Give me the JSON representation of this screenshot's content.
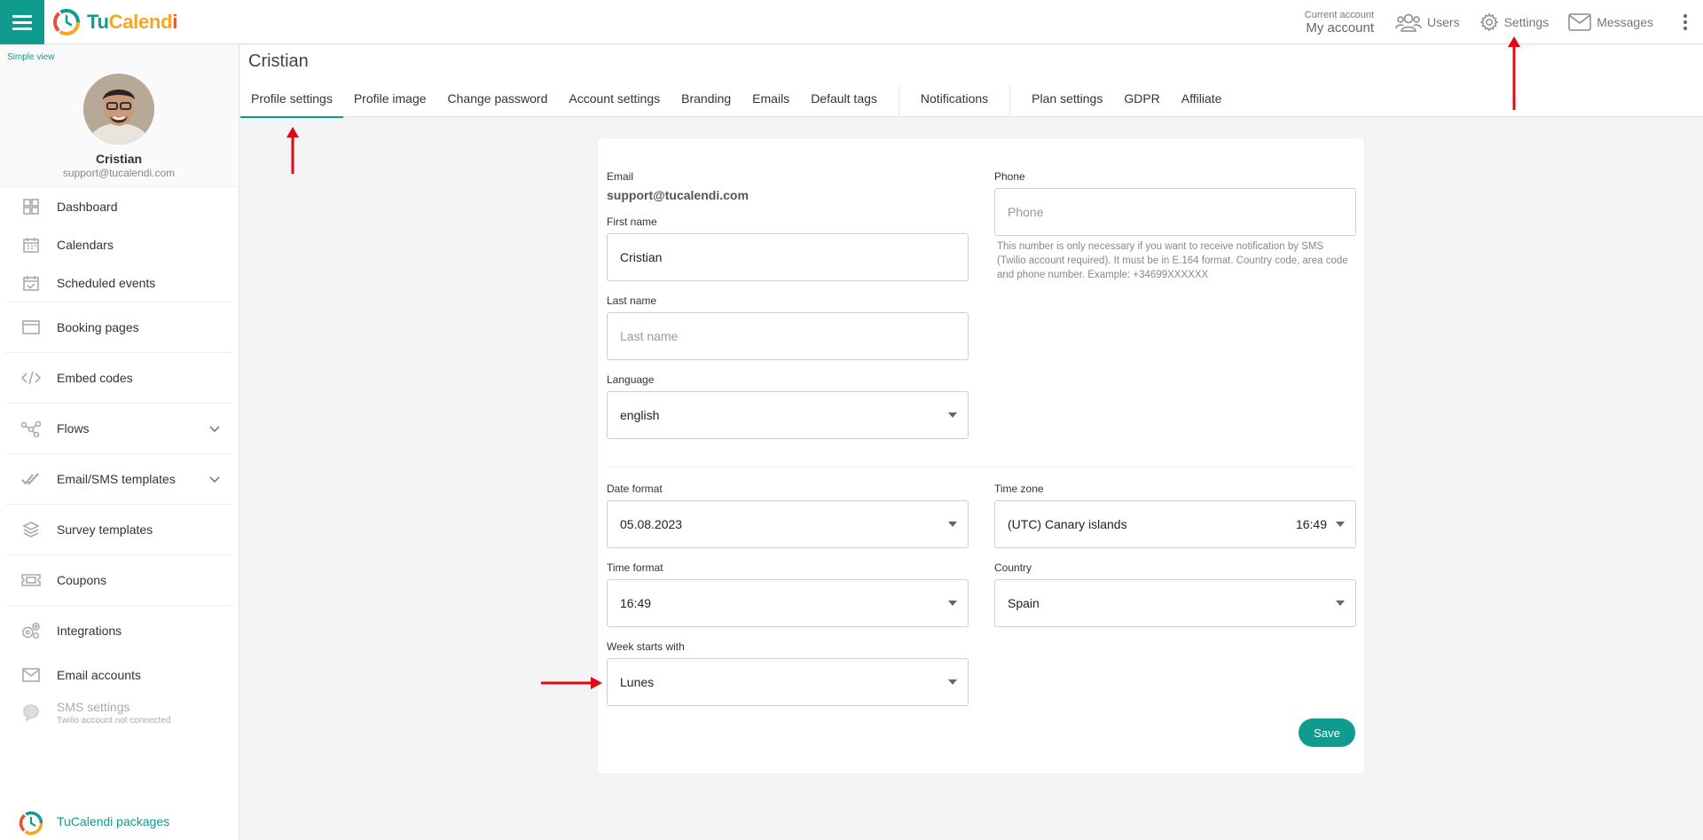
{
  "app": {
    "name_tu": "Tu",
    "name_calend": "Calend",
    "name_i": "i"
  },
  "topnav": {
    "account_small": "Current account",
    "account_big": "My account",
    "users": "Users",
    "settings": "Settings",
    "messages": "Messages"
  },
  "sidebar": {
    "simple_view": "Simple view",
    "user_name": "Cristian",
    "user_email": "support@tucalendi.com",
    "items": [
      {
        "label": "Dashboard"
      },
      {
        "label": "Calendars"
      },
      {
        "label": "Scheduled events"
      },
      {
        "label": "Booking pages"
      },
      {
        "label": "Embed codes"
      },
      {
        "label": "Flows"
      },
      {
        "label": "Email/SMS templates"
      },
      {
        "label": "Survey templates"
      },
      {
        "label": "Coupons"
      },
      {
        "label": "Integrations"
      },
      {
        "label": "Email accounts"
      },
      {
        "label": "SMS settings",
        "sub": "Twilio account not connected"
      }
    ],
    "packages": "TuCalendi packages"
  },
  "header": {
    "title": "Cristian",
    "tabs": [
      {
        "label": "Profile settings"
      },
      {
        "label": "Profile image"
      },
      {
        "label": "Change password"
      },
      {
        "label": "Account settings"
      },
      {
        "label": "Branding"
      },
      {
        "label": "Emails"
      },
      {
        "label": "Default tags"
      },
      {
        "label": "Notifications"
      },
      {
        "label": "Plan settings"
      },
      {
        "label": "GDPR"
      },
      {
        "label": "Affiliate"
      }
    ]
  },
  "form": {
    "email_label": "Email",
    "email_value": "support@tucalendi.com",
    "first_name_label": "First name",
    "first_name_value": "Cristian",
    "last_name_label": "Last name",
    "last_name_placeholder": "Last name",
    "language_label": "Language",
    "language_value": "english",
    "phone_label": "Phone",
    "phone_placeholder": "Phone",
    "phone_hint": "This number is only necessary if you want to receive notification by SMS (Twilio account required). It must be in E.164 format. Country code, area code and phone number. Example: +34699XXXXXX",
    "date_format_label": "Date format",
    "date_format_value": "05.08.2023",
    "time_zone_label": "Time zone",
    "time_zone_value": "(UTC) Canary islands",
    "time_zone_time": "16:49",
    "time_format_label": "Time format",
    "time_format_value": "16:49",
    "country_label": "Country",
    "country_value": "Spain",
    "week_start_label": "Week starts with",
    "week_start_value": "Lunes",
    "save_label": "Save"
  },
  "colors": {
    "accent": "#0f9b8e",
    "annotation": "#e30613"
  }
}
